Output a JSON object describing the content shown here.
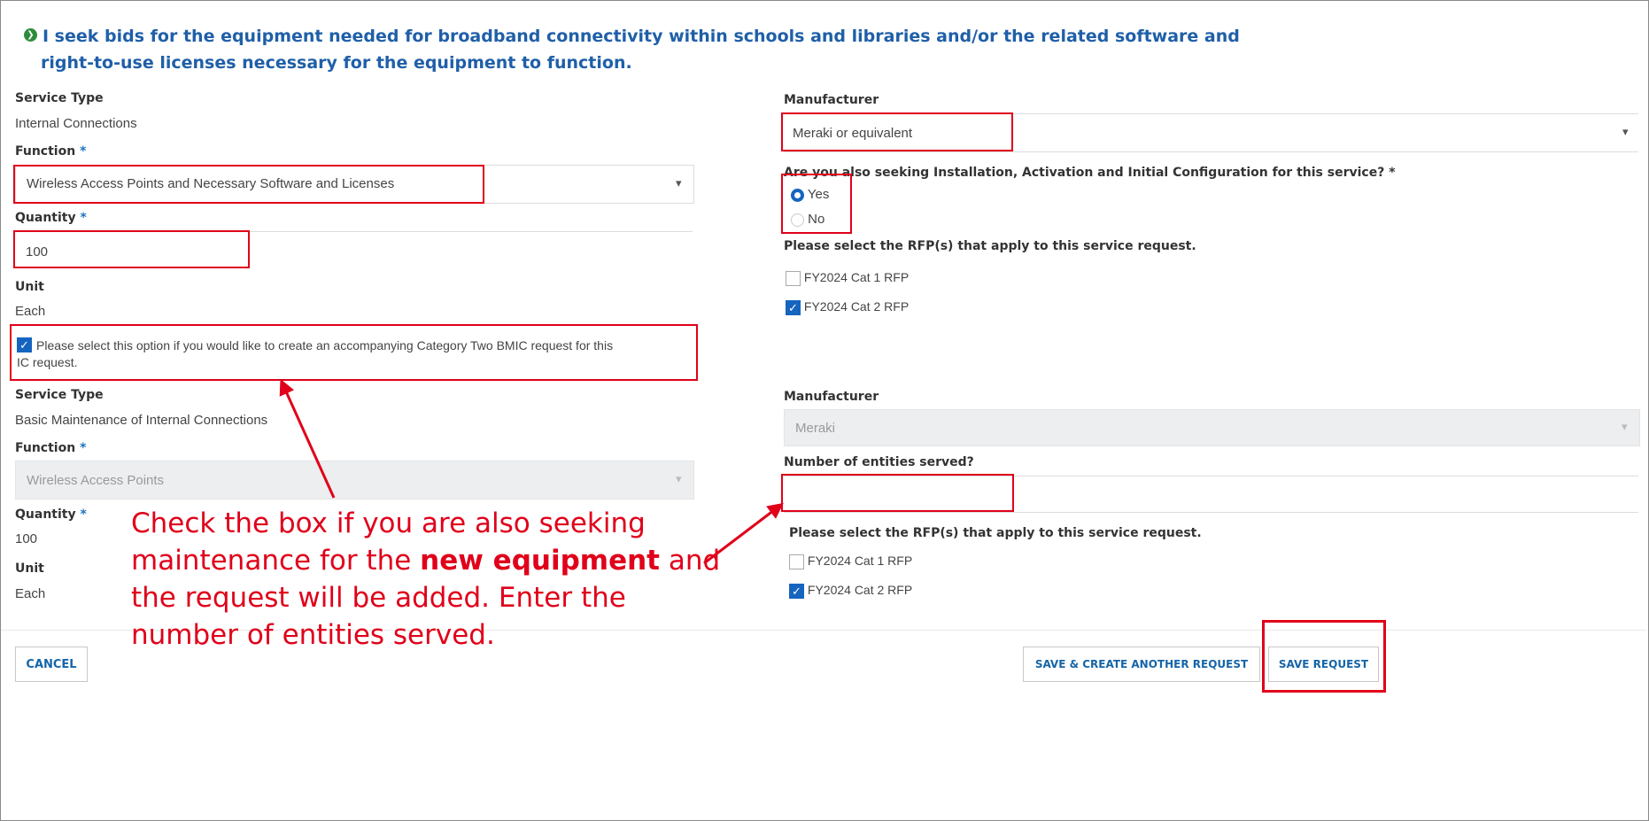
{
  "heading": {
    "line1": "I seek bids for the equipment needed for broadband connectivity within schools and libraries and/or the related software and",
    "line2": "right-to-use licenses necessary for the  equipment to function."
  },
  "ic": {
    "service_type_label": "Service Type",
    "service_type_value": "Internal Connections",
    "function_label": "Function",
    "function_value": "Wireless Access Points and Necessary Software and Licenses",
    "quantity_label": "Quantity",
    "quantity_value": "100",
    "unit_label": "Unit",
    "unit_value": "Each",
    "manufacturer_label": "Manufacturer",
    "manufacturer_value": "Meraki or equivalent",
    "install_question": "Are you also seeking Installation, Activation and Initial Configuration for this service?",
    "install_yes": "Yes",
    "install_no": "No",
    "install_selected": "Yes",
    "rfp_label": "Please select the RFP(s) that apply to this service request.",
    "rfp_options": [
      {
        "label": "FY2024 Cat 1 RFP",
        "checked": false
      },
      {
        "label": "FY2024 Cat 2 RFP",
        "checked": true
      }
    ]
  },
  "bmic_checkbox": {
    "checked": true,
    "label_line1": "Please select this option if you would like to create an accompanying Category Two BMIC request for this",
    "label_line2": "IC request."
  },
  "bmic": {
    "service_type_label": "Service Type",
    "service_type_value": "Basic Maintenance of Internal Connections",
    "function_label": "Function",
    "function_value": "Wireless Access Points",
    "quantity_label": "Quantity",
    "quantity_value": "100",
    "unit_label": "Unit",
    "unit_value": "Each",
    "manufacturer_label": "Manufacturer",
    "manufacturer_value": "Meraki",
    "entities_label": "Number of entities served?",
    "entities_value": "",
    "rfp_label": "Please select the RFP(s) that apply to this service request.",
    "rfp_options": [
      {
        "label": "FY2024 Cat 1 RFP",
        "checked": false
      },
      {
        "label": "FY2024 Cat 2 RFP",
        "checked": true
      }
    ]
  },
  "required_mark": "*",
  "annotation": {
    "line1": "Check the box if you are also seeking",
    "line2_pre": "maintenance for the ",
    "line2_bold": "new equipment",
    "line2_post": " and",
    "line3": "the request will be added. Enter the",
    "line4": "number of entities served."
  },
  "buttons": {
    "cancel": "CANCEL",
    "save_create": "SAVE & CREATE ANOTHER REQUEST",
    "save": "SAVE REQUEST"
  },
  "colors": {
    "accent": "#1565c0",
    "heading": "#1f5fa8",
    "annotation_red": "#e0001a"
  }
}
